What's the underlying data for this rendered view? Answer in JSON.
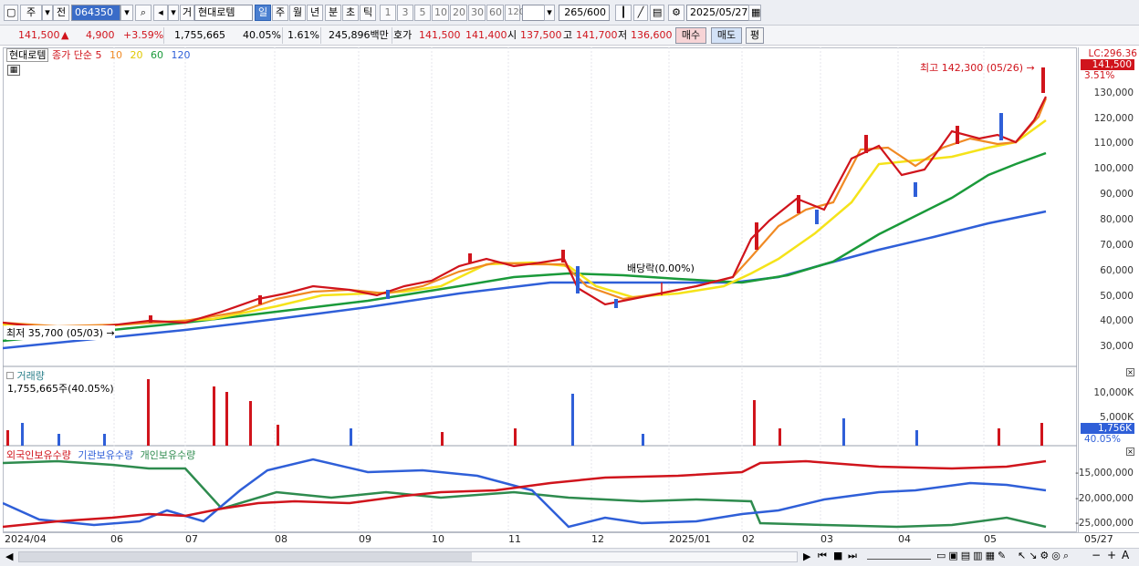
{
  "toolbar": {
    "market": "주",
    "prev": "전",
    "code": "064350",
    "type_mark": "거",
    "stock_name": "현대로템",
    "periods": [
      "일",
      "주",
      "월",
      "년",
      "분",
      "초",
      "틱"
    ],
    "intervals": [
      "1",
      "3",
      "5",
      "10",
      "20",
      "30",
      "60",
      "120"
    ],
    "count": "265",
    "count_max": "/600",
    "date": "2025/05/27"
  },
  "info": {
    "price": "141,500",
    "up_arrow": "▲",
    "change": "4,900",
    "change_pct": "+3.59%",
    "volume": "1,755,665",
    "volume_pct": "40.05%",
    "turnover_pct": "1.61%",
    "trade_value": "245,896백만",
    "quote_label": "호가",
    "ask": "141,500",
    "bid": "141,400",
    "open_label": "시",
    "open": "137,500",
    "high_label": "고",
    "high": "141,700",
    "low_label": "저",
    "low": "136,600",
    "buy": "매수",
    "sell": "매도",
    "avg": "평"
  },
  "price_panel": {
    "legend_name": "현대로템",
    "legend_type": "종가 단순",
    "ma_periods": [
      "5",
      "10",
      "20",
      "60",
      "120"
    ],
    "ma_colors": [
      "#d0141c",
      "#f08a24",
      "#f5e31a",
      "#1a9a3a",
      "#2f5fd8"
    ],
    "high_note": "최고 142,300 (05/26) →",
    "low_note": "최저 35,700 (05/03) →",
    "dividend_note": "배당락(0.00%)",
    "lc_label": "LC:296.36",
    "last_price": "141,500",
    "last_pct": "3.51%",
    "y_ticks": [
      "130,000",
      "120,000",
      "110,000",
      "100,000",
      "90,000",
      "80,000",
      "70,000",
      "60,000",
      "50,000",
      "40,000",
      "30,000"
    ]
  },
  "volume_panel": {
    "title": "거래량",
    "value": "1,755,665주(40.05%)",
    "y_ticks": [
      "10,000K",
      "5,000K"
    ],
    "last": "1,756K",
    "last_pct": "40.05%"
  },
  "holding_panel": {
    "series": [
      "외국인보유수량",
      "기관보유수량",
      "개인보유수량"
    ],
    "colors": [
      "#d0141c",
      "#2f5fd8",
      "#2e8b4e"
    ],
    "y_ticks": [
      "-15,000,000",
      "-20,000,000",
      "-25,000,000"
    ]
  },
  "x_axis": {
    "labels": [
      "2024/04",
      "06",
      "07",
      "08",
      "09",
      "10",
      "11",
      "12",
      "2025/01",
      "02",
      "03",
      "04",
      "05",
      "05/27"
    ]
  }
}
